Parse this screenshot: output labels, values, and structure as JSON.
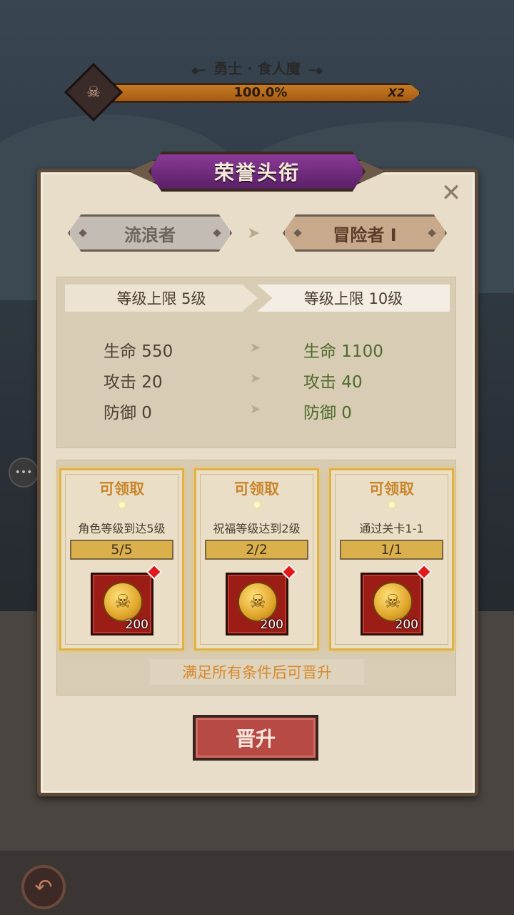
{
  "boss": {
    "name": "勇士 · 食人魔",
    "progress_text": "100.0%",
    "progress_value": 1.0,
    "multiplier": "X2",
    "icon": "ogre-skull-icon"
  },
  "dialog": {
    "title": "荣誉头衔",
    "close_icon": "close-icon",
    "current_rank": "流浪者",
    "next_rank": "冒险者 I",
    "current_level_cap": "等级上限 5级",
    "next_level_cap": "等级上限 10级",
    "stats": [
      {
        "old": "生命 550",
        "new": "生命 1100"
      },
      {
        "old": "攻击 20",
        "new": "攻击 40"
      },
      {
        "old": "防御 0",
        "new": "防御 0"
      }
    ],
    "tasks": [
      {
        "status": "可领取",
        "desc": "角色等级到达5级",
        "progress": "5/5",
        "reward_amount": "200",
        "reward_icon": "skull-coin-icon"
      },
      {
        "status": "可领取",
        "desc": "祝福等级达到2级",
        "progress": "2/2",
        "reward_amount": "200",
        "reward_icon": "skull-coin-icon"
      },
      {
        "status": "可领取",
        "desc": "通过关卡1-1",
        "progress": "1/1",
        "reward_amount": "200",
        "reward_icon": "skull-coin-icon"
      }
    ],
    "hint": "满足所有条件后可晋升",
    "promote_label": "晋升"
  },
  "colors": {
    "panel": "#e7ddc8",
    "title_plate": "#7a2f88",
    "stat_new": "#4e6a2a",
    "task_status": "#c8852b",
    "promote_button": "#b84a45"
  }
}
